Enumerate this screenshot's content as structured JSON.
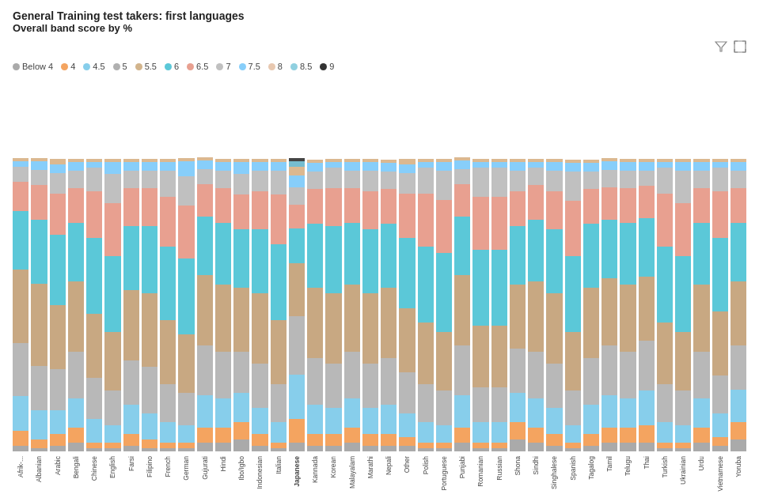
{
  "title": {
    "main": "General Training test takers: first languages",
    "sub": "Overall band score by %"
  },
  "legend": [
    {
      "label": "Below 4",
      "color": "#aaaaaa"
    },
    {
      "label": "4",
      "color": "#f4a460"
    },
    {
      "label": "4.5",
      "color": "#87CEEB"
    },
    {
      "label": "5",
      "color": "#b0b0b0"
    },
    {
      "label": "5.5",
      "color": "#d2b48c"
    },
    {
      "label": "6",
      "color": "#5bc8d8"
    },
    {
      "label": "6.5",
      "color": "#e8a090"
    },
    {
      "label": "7",
      "color": "#c0c0c0"
    },
    {
      "label": "7.5",
      "color": "#87cefa"
    },
    {
      "label": "8",
      "color": "#e8c8b0"
    },
    {
      "label": "8.5",
      "color": "#90d0e0"
    },
    {
      "label": "9",
      "color": "#333333"
    }
  ],
  "languages": [
    {
      "label": "Afrik-...",
      "bold": false
    },
    {
      "label": "Albanian",
      "bold": false
    },
    {
      "label": "Arabic",
      "bold": false
    },
    {
      "label": "Bengali",
      "bold": false
    },
    {
      "label": "Chinese",
      "bold": false
    },
    {
      "label": "English",
      "bold": false
    },
    {
      "label": "Farsi",
      "bold": false
    },
    {
      "label": "Filipino",
      "bold": false
    },
    {
      "label": "French",
      "bold": false
    },
    {
      "label": "German",
      "bold": false
    },
    {
      "label": "Gujurati",
      "bold": false
    },
    {
      "label": "Hindi",
      "bold": false
    },
    {
      "label": "Ibo/Igbo",
      "bold": false
    },
    {
      "label": "Indonesian",
      "bold": false
    },
    {
      "label": "Italian",
      "bold": false
    },
    {
      "label": "Japanese",
      "bold": true
    },
    {
      "label": "Kannada",
      "bold": false
    },
    {
      "label": "Korean",
      "bold": false
    },
    {
      "label": "Malayalam",
      "bold": false
    },
    {
      "label": "Marathi",
      "bold": false
    },
    {
      "label": "Nepali",
      "bold": false
    },
    {
      "label": "Other",
      "bold": false
    },
    {
      "label": "Polish",
      "bold": false
    },
    {
      "label": "Portuguese",
      "bold": false
    },
    {
      "label": "Punjabi",
      "bold": false
    },
    {
      "label": "Romanian",
      "bold": false
    },
    {
      "label": "Russian",
      "bold": false
    },
    {
      "label": "Shona",
      "bold": false
    },
    {
      "label": "Sindhi",
      "bold": false
    },
    {
      "label": "Singhalese",
      "bold": false
    },
    {
      "label": "Spanish",
      "bold": false
    },
    {
      "label": "Tagalog",
      "bold": false
    },
    {
      "label": "Tamil",
      "bold": false
    },
    {
      "label": "Telugu",
      "bold": false
    },
    {
      "label": "Thai",
      "bold": false
    },
    {
      "label": "Turkish",
      "bold": false
    },
    {
      "label": "Ukrainian",
      "bold": false
    },
    {
      "label": "Urdu",
      "bold": false
    },
    {
      "label": "Vietnamese",
      "bold": false
    },
    {
      "label": "Yoruba",
      "bold": false
    }
  ],
  "bars": [
    [
      2,
      5,
      12,
      18,
      25,
      20,
      10,
      5,
      2,
      1,
      0,
      0
    ],
    [
      1,
      3,
      10,
      15,
      28,
      22,
      12,
      5,
      3,
      1,
      0,
      0
    ],
    [
      2,
      4,
      8,
      14,
      22,
      24,
      14,
      7,
      3,
      2,
      0,
      0
    ],
    [
      3,
      5,
      10,
      16,
      24,
      20,
      12,
      6,
      3,
      1,
      0,
      0
    ],
    [
      1,
      2,
      8,
      14,
      22,
      26,
      16,
      8,
      2,
      1,
      0,
      0
    ],
    [
      1,
      2,
      6,
      12,
      20,
      26,
      18,
      10,
      4,
      1,
      0,
      0
    ],
    [
      2,
      4,
      10,
      15,
      24,
      22,
      13,
      6,
      3,
      1,
      0,
      0
    ],
    [
      1,
      3,
      9,
      16,
      25,
      23,
      13,
      6,
      3,
      1,
      0,
      0
    ],
    [
      1,
      2,
      7,
      13,
      22,
      25,
      17,
      9,
      3,
      1,
      0,
      0
    ],
    [
      1,
      2,
      6,
      11,
      20,
      26,
      18,
      10,
      5,
      1,
      0,
      0
    ],
    [
      3,
      5,
      11,
      17,
      24,
      20,
      11,
      5,
      3,
      1,
      0,
      0
    ],
    [
      3,
      5,
      10,
      16,
      23,
      21,
      12,
      6,
      3,
      1,
      0,
      0
    ],
    [
      4,
      6,
      10,
      14,
      22,
      20,
      12,
      7,
      4,
      1,
      0,
      0
    ],
    [
      2,
      4,
      9,
      15,
      24,
      22,
      13,
      7,
      3,
      1,
      0,
      0
    ],
    [
      1,
      2,
      7,
      13,
      22,
      26,
      17,
      8,
      3,
      1,
      0,
      0
    ],
    [
      3,
      8,
      15,
      20,
      18,
      12,
      8,
      6,
      4,
      3,
      2,
      1
    ],
    [
      2,
      4,
      10,
      16,
      24,
      22,
      12,
      6,
      3,
      1,
      0,
      0
    ],
    [
      2,
      4,
      9,
      15,
      24,
      23,
      13,
      7,
      2,
      1,
      0,
      0
    ],
    [
      3,
      5,
      10,
      16,
      23,
      21,
      12,
      6,
      3,
      1,
      0,
      0
    ],
    [
      2,
      4,
      9,
      15,
      24,
      22,
      13,
      7,
      3,
      1,
      0,
      0
    ],
    [
      2,
      4,
      10,
      16,
      24,
      22,
      12,
      6,
      3,
      1,
      0,
      0
    ],
    [
      2,
      3,
      8,
      14,
      22,
      24,
      15,
      7,
      3,
      2,
      0,
      0
    ],
    [
      1,
      2,
      7,
      13,
      21,
      26,
      18,
      9,
      2,
      1,
      0,
      0
    ],
    [
      1,
      2,
      6,
      12,
      20,
      27,
      18,
      10,
      3,
      1,
      0,
      0
    ],
    [
      3,
      5,
      11,
      17,
      24,
      20,
      11,
      5,
      3,
      1,
      0,
      0
    ],
    [
      1,
      2,
      7,
      12,
      21,
      26,
      18,
      10,
      2,
      1,
      0,
      0
    ],
    [
      1,
      2,
      7,
      12,
      21,
      26,
      18,
      10,
      2,
      1,
      0,
      0
    ],
    [
      4,
      6,
      10,
      15,
      22,
      20,
      12,
      7,
      3,
      1,
      0,
      0
    ],
    [
      3,
      5,
      10,
      16,
      24,
      21,
      12,
      6,
      2,
      1,
      0,
      0
    ],
    [
      2,
      4,
      9,
      15,
      24,
      22,
      13,
      7,
      3,
      1,
      0,
      0
    ],
    [
      1,
      2,
      6,
      12,
      20,
      26,
      19,
      10,
      3,
      1,
      0,
      0
    ],
    [
      2,
      4,
      10,
      16,
      24,
      22,
      12,
      6,
      3,
      1,
      0,
      0
    ],
    [
      3,
      5,
      11,
      17,
      23,
      20,
      11,
      6,
      3,
      1,
      0,
      0
    ],
    [
      3,
      5,
      10,
      16,
      23,
      21,
      12,
      6,
      3,
      1,
      0,
      0
    ],
    [
      3,
      6,
      12,
      17,
      22,
      20,
      11,
      5,
      3,
      1,
      0,
      0
    ],
    [
      1,
      2,
      7,
      13,
      21,
      26,
      18,
      9,
      2,
      1,
      0,
      0
    ],
    [
      1,
      2,
      6,
      12,
      20,
      26,
      18,
      11,
      3,
      1,
      0,
      0
    ],
    [
      3,
      5,
      10,
      16,
      23,
      21,
      12,
      6,
      3,
      1,
      0,
      0
    ],
    [
      2,
      3,
      8,
      13,
      22,
      25,
      16,
      8,
      2,
      1,
      0,
      0
    ],
    [
      4,
      6,
      11,
      15,
      22,
      20,
      12,
      6,
      3,
      1,
      0,
      0
    ]
  ],
  "colors": [
    "#aaaaaa",
    "#f4a460",
    "#87ceeb",
    "#b8b8b8",
    "#c8a882",
    "#5bc8d8",
    "#e8a090",
    "#c0c0c0",
    "#87cefa",
    "#dbb890",
    "#75bdd0",
    "#444444"
  ],
  "icons": {
    "filter": "⊿",
    "expand": "⤢"
  }
}
